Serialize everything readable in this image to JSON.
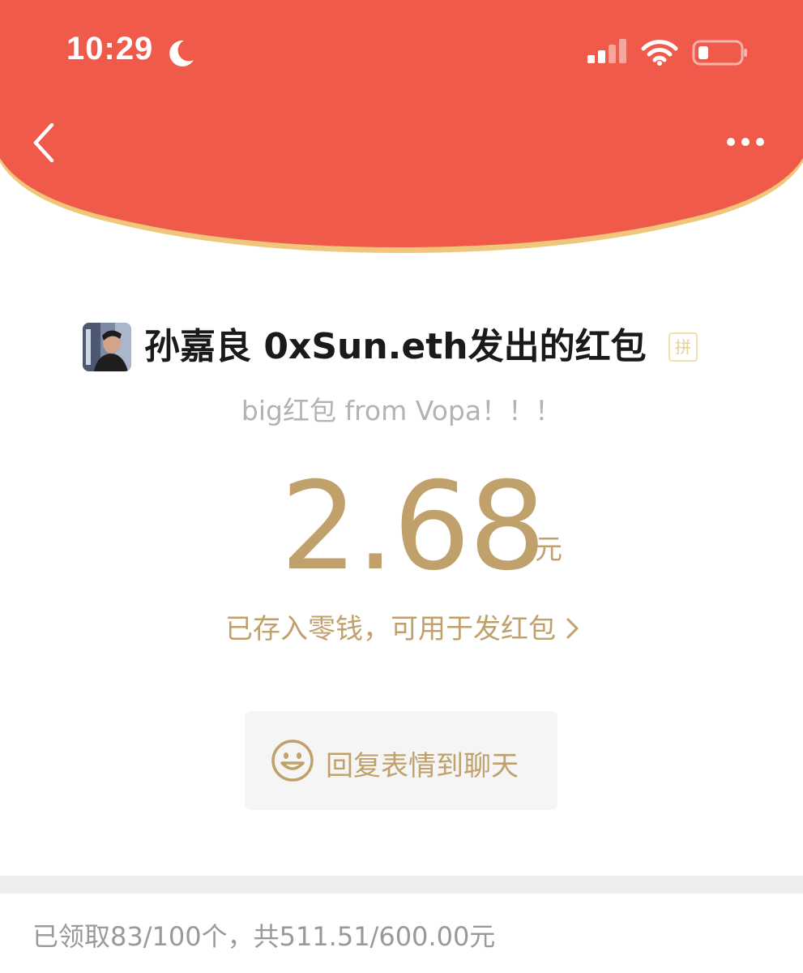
{
  "colors": {
    "header": "#ef5a4a",
    "header_edge": "#f0c67a",
    "gold": "#c0a06b",
    "title": "#1a1a1a",
    "muted": "#b3b3b3",
    "summary": "#999999"
  },
  "status_bar": {
    "time": "10:29",
    "icons": [
      "moon-icon",
      "cellular-signal-icon",
      "wifi-icon",
      "battery-icon"
    ]
  },
  "nav": {
    "back_icon": "chevron-left-icon",
    "more_icon": "ellipsis-icon"
  },
  "packet": {
    "sender_title": "孙嘉良 0xSun.eth发出的红包",
    "pin_badge": "拼",
    "blessing": "big红包 from Vopa！！！",
    "amount": "2.68",
    "unit": "元",
    "wallet_note": "已存入零钱，可用于发红包",
    "reply_button": "回复表情到聊天"
  },
  "summary": {
    "text": "已领取83/100个，共511.51/600.00元"
  }
}
